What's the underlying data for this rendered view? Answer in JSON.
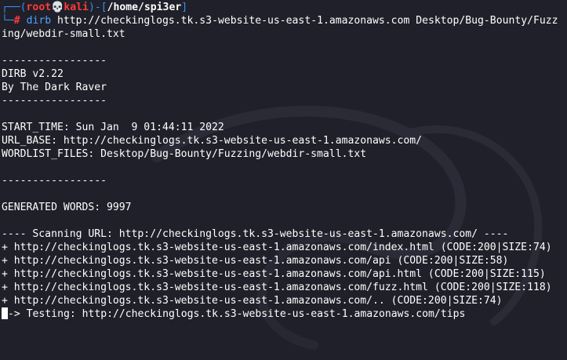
{
  "prompt": {
    "corner_top": "┌──",
    "open_paren": "(",
    "user": "root",
    "skull": "💀",
    "host": "kali",
    "mid": ")-[",
    "path": "/home/spi3er",
    "close_bracket": "]",
    "corner_bottom": "└─",
    "hash": "#",
    "command_name": "dirb",
    "command_args_line1": " http://checkinglogs.tk.s3-website-us-east-1.amazonaws.com Desktop/Bug-Bounty/Fuzz",
    "command_args_line2": "ing/webdir-small.txt"
  },
  "output": {
    "sep1": "-----------------",
    "version": "DIRB v2.22",
    "author": "By The Dark Raver",
    "sep2": "-----------------",
    "start_time": "START_TIME: Sun Jan  9 01:44:11 2022",
    "url_base": "URL_BASE: http://checkinglogs.tk.s3-website-us-east-1.amazonaws.com/",
    "wordlist": "WORDLIST_FILES: Desktop/Bug-Bounty/Fuzzing/webdir-small.txt",
    "sep3": "-----------------",
    "generated": "GENERATED WORDS: 9997",
    "scanning": "---- Scanning URL: http://checkinglogs.tk.s3-website-us-east-1.amazonaws.com/ ----",
    "results": [
      "+ http://checkinglogs.tk.s3-website-us-east-1.amazonaws.com/index.html (CODE:200|SIZE:74)",
      "+ http://checkinglogs.tk.s3-website-us-east-1.amazonaws.com/api (CODE:200|SIZE:58)",
      "+ http://checkinglogs.tk.s3-website-us-east-1.amazonaws.com/api.html (CODE:200|SIZE:115)",
      "+ http://checkinglogs.tk.s3-website-us-east-1.amazonaws.com/fuzz.html (CODE:200|SIZE:118)",
      "+ http://checkinglogs.tk.s3-website-us-east-1.amazonaws.com/.. (CODE:200|SIZE:74)"
    ],
    "testing": "-> Testing: http://checkinglogs.tk.s3-website-us-east-1.amazonaws.com/tips"
  },
  "colors": {
    "background": "#1f2029",
    "prompt_frame": "#3b8eea",
    "prompt_user": "#ff3b3b",
    "text": "#ffffff"
  }
}
